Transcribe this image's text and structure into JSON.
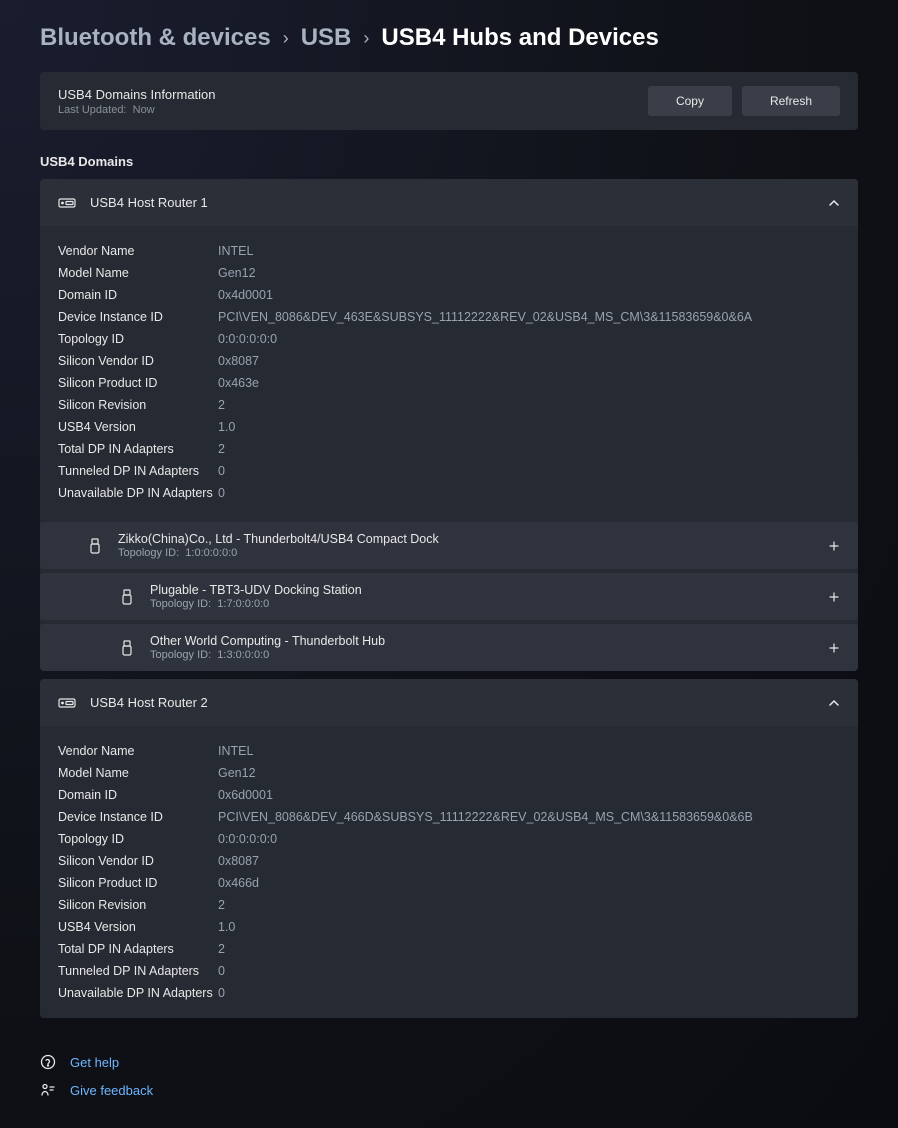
{
  "breadcrumb": {
    "crumb1": "Bluetooth & devices",
    "crumb2": "USB",
    "crumb3": "USB4 Hubs and Devices"
  },
  "info_bar": {
    "title": "USB4 Domains Information",
    "last_updated_label": "Last Updated:",
    "last_updated_value": "Now",
    "copy_label": "Copy",
    "refresh_label": "Refresh"
  },
  "section_title": "USB4 Domains",
  "routers": [
    {
      "title": "USB4 Host Router 1",
      "details": [
        {
          "key": "Vendor Name",
          "val": "INTEL"
        },
        {
          "key": "Model Name",
          "val": "Gen12"
        },
        {
          "key": "Domain ID",
          "val": "0x4d0001"
        },
        {
          "key": "Device Instance ID",
          "val": "PCI\\VEN_8086&DEV_463E&SUBSYS_11112222&REV_02&USB4_MS_CM\\3&11583659&0&6A"
        },
        {
          "key": "Topology ID",
          "val": "0:0:0:0:0:0"
        },
        {
          "key": "Silicon Vendor ID",
          "val": "0x8087"
        },
        {
          "key": "Silicon Product ID",
          "val": "0x463e"
        },
        {
          "key": "Silicon Revision",
          "val": "2"
        },
        {
          "key": "USB4 Version",
          "val": "1.0"
        },
        {
          "key": "Total DP IN Adapters",
          "val": "2"
        },
        {
          "key": "Tunneled DP IN Adapters",
          "val": "0"
        },
        {
          "key": "Unavailable DP IN Adapters",
          "val": "0"
        }
      ],
      "devices": [
        {
          "name": "Zikko(China)Co., Ltd - Thunderbolt4/USB4 Compact Dock",
          "sub_label": "Topology ID:",
          "sub_val": "1:0:0:0:0:0",
          "nested": false
        },
        {
          "name": "Plugable - TBT3-UDV Docking Station",
          "sub_label": "Topology ID:",
          "sub_val": "1:7:0:0:0:0",
          "nested": true
        },
        {
          "name": "Other World Computing - Thunderbolt Hub",
          "sub_label": "Topology ID:",
          "sub_val": "1:3:0:0:0:0",
          "nested": true
        }
      ]
    },
    {
      "title": "USB4 Host Router 2",
      "details": [
        {
          "key": "Vendor Name",
          "val": "INTEL"
        },
        {
          "key": "Model Name",
          "val": "Gen12"
        },
        {
          "key": "Domain ID",
          "val": "0x6d0001"
        },
        {
          "key": "Device Instance ID",
          "val": "PCI\\VEN_8086&DEV_466D&SUBSYS_11112222&REV_02&USB4_MS_CM\\3&11583659&0&6B"
        },
        {
          "key": "Topology ID",
          "val": "0:0:0:0:0:0"
        },
        {
          "key": "Silicon Vendor ID",
          "val": "0x8087"
        },
        {
          "key": "Silicon Product ID",
          "val": "0x466d"
        },
        {
          "key": "Silicon Revision",
          "val": "2"
        },
        {
          "key": "USB4 Version",
          "val": "1.0"
        },
        {
          "key": "Total DP IN Adapters",
          "val": "2"
        },
        {
          "key": "Tunneled DP IN Adapters",
          "val": "0"
        },
        {
          "key": "Unavailable DP IN Adapters",
          "val": "0"
        }
      ],
      "devices": []
    }
  ],
  "footer": {
    "help": "Get help",
    "feedback": "Give feedback"
  }
}
